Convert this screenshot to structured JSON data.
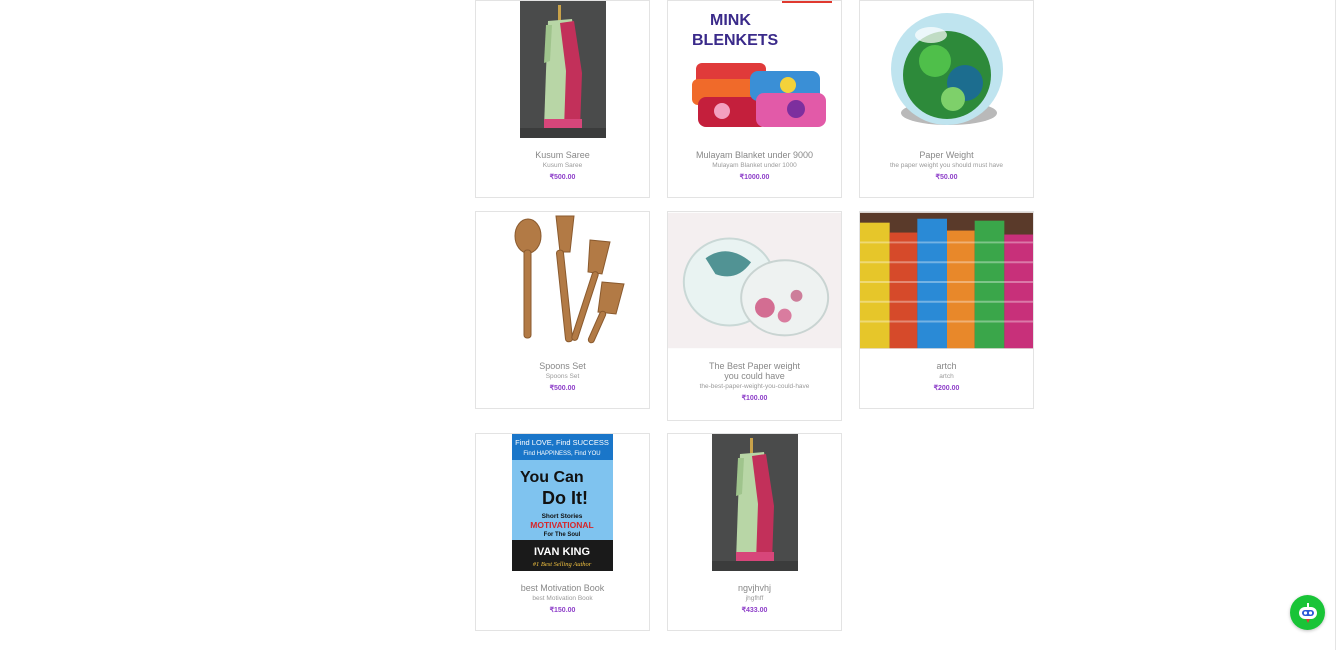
{
  "currency_symbol": "₹",
  "products": [
    {
      "name": "Kusum Saree",
      "description": "Kusum Saree",
      "price": "₹500.00",
      "image_icon": "saree-image"
    },
    {
      "name": "Mulayam Blanket under 9000",
      "description": "Mulayam Blanket under 1000",
      "price": "₹1000.00",
      "image_icon": "blanket-image",
      "image_text": "MINK BLENKETS"
    },
    {
      "name": "Paper Weight",
      "description": "the paper weight you should must have",
      "price": "₹50.00",
      "image_icon": "glass-paperweight-image"
    },
    {
      "name": "Spoons Set",
      "description": "Spoons Set",
      "price": "₹500.00",
      "image_icon": "wooden-spoons-image"
    },
    {
      "name": "The Best Paper weight you could have",
      "description": "the-best-paper-weight-you-could-have",
      "price": "₹100.00",
      "image_icon": "resin-paperweight-image"
    },
    {
      "name": "artch",
      "description": "artch",
      "price": "₹200.00",
      "image_icon": "bangles-image"
    },
    {
      "name": "best Motivation Book",
      "description": "best Motivation Book",
      "price": "₹150.00",
      "image_icon": "book-cover-image",
      "image_text": {
        "line1": "Find LOVE, Find SUCCESS",
        "line2": "Find HAPPINESS, Find YOU",
        "title1": "You Can",
        "title2": "Do It!",
        "tag1": "Short Stories",
        "tag2": "MOTIVATIONAL",
        "tag3": "For The Soul",
        "author": "IVAN KING",
        "badge": "#1 Best Selling Author"
      }
    },
    {
      "name": "ngvjhvhj",
      "description": "jhgfhff",
      "price": "₹433.00",
      "image_icon": "saree-image"
    }
  ],
  "chat_widget": {
    "icon": "chatbot-icon"
  },
  "colors": {
    "price": "#8e3fc9",
    "title": "#888888",
    "chat": "#19c437"
  }
}
